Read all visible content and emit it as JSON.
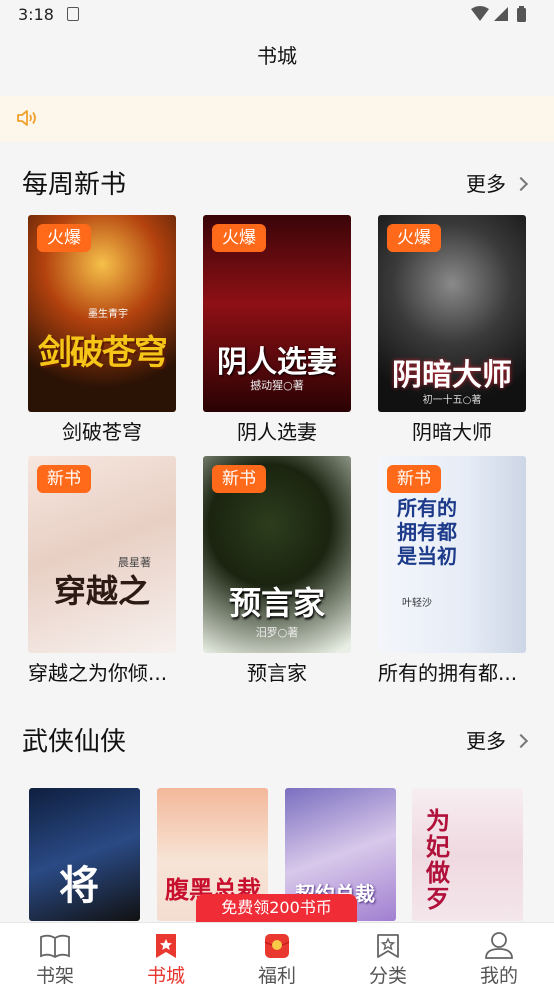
{
  "status_bar": {
    "time": "3:18"
  },
  "header": {
    "title": "书城"
  },
  "weekly": {
    "title": "每周新书",
    "more": "更多",
    "books": [
      {
        "name": "剑破苍穹",
        "badge": "火爆",
        "cover_text": "剑破苍穹",
        "author": "墨生青宇"
      },
      {
        "name": "阴人选妻",
        "badge": "火爆",
        "cover_text": "阴人选妻",
        "author": "撼动猩○著"
      },
      {
        "name": "阴暗大师",
        "badge": "火爆",
        "cover_text": "阴暗大师",
        "author": "初一十五○著"
      },
      {
        "name": "穿越之为你倾...",
        "badge": "新书",
        "cover_text": "穿越之",
        "author": "晨星著"
      },
      {
        "name": "预言家",
        "badge": "新书",
        "cover_text": "预言家",
        "author": "汨罗○著"
      },
      {
        "name": "所有的拥有都...",
        "badge": "新书",
        "cover_text": "所有的拥有都是当初",
        "author": "叶轻沙"
      }
    ]
  },
  "wuxia": {
    "title": "武侠仙侠",
    "more": "更多",
    "covers": [
      "将",
      "腹黑总裁",
      "契约总裁",
      "为妃做歹"
    ]
  },
  "promo": {
    "label": "免费领200书币"
  },
  "bottom_nav": [
    {
      "label": "书架",
      "icon": "book-open-icon",
      "active": false
    },
    {
      "label": "书城",
      "icon": "star-bookmark-icon",
      "active": true
    },
    {
      "label": "福利",
      "icon": "red-envelope-icon",
      "active": false
    },
    {
      "label": "分类",
      "icon": "category-star-icon",
      "active": false
    },
    {
      "label": "我的",
      "icon": "user-profile-icon",
      "active": false
    }
  ],
  "colors": {
    "accent": "#e8382f",
    "badge": "#ff6a1a",
    "promo": "#f02d36",
    "notice_bg": "#fdf6ea"
  }
}
